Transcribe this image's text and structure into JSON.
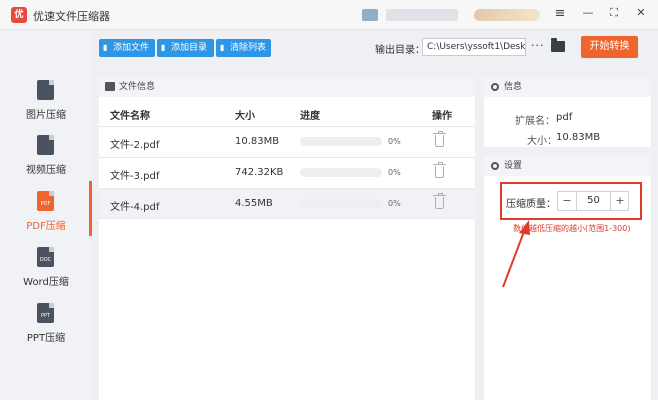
{
  "app": {
    "title": "优速文件压缩器",
    "logo_text": "优"
  },
  "window_controls": [
    "≡",
    "—",
    "⛶",
    "✕"
  ],
  "sidebar": {
    "items": [
      {
        "label": "图片压缩",
        "icon": "image-file-icon",
        "badge": ""
      },
      {
        "label": "视频压缩",
        "icon": "video-file-icon",
        "badge": ""
      },
      {
        "label": "PDF压缩",
        "icon": "pdf-file-icon",
        "badge": "PDF"
      },
      {
        "label": "Word压缩",
        "icon": "doc-file-icon",
        "badge": "DOC"
      },
      {
        "label": "PPT压缩",
        "icon": "ppt-file-icon",
        "badge": "PPT"
      }
    ]
  },
  "toolbar": {
    "add_file": "添加文件",
    "add_dir": "添加目录",
    "clear_list": "清除列表",
    "output_label": "输出目录：",
    "output_path": "C:\\Users\\yssoft1\\Deskt",
    "more": "···",
    "start": "开始转换"
  },
  "file_panel": {
    "title": "文件信息",
    "columns": {
      "name": "文件名称",
      "size": "大小",
      "progress": "进度",
      "action": "操作"
    },
    "rows": [
      {
        "name": "文件-2.pdf",
        "size": "10.83MB",
        "progress": "0%"
      },
      {
        "name": "文件-3.pdf",
        "size": "742.32KB",
        "progress": "0%"
      },
      {
        "name": "文件-4.pdf",
        "size": "4.55MB",
        "progress": "0%"
      }
    ]
  },
  "info_panel": {
    "title": "信息",
    "ext_label": "扩展名：",
    "ext_value": "pdf",
    "size_label": "大小：",
    "size_value": "10.83MB"
  },
  "settings": {
    "title": "设置",
    "quality_label": "压缩质量：",
    "minus": "−",
    "value": "50",
    "plus": "+",
    "hint": "数值越低压缩的越小(范围1-300)"
  },
  "colors": {
    "accent": "#f0642d",
    "primary": "#2d96e6",
    "annotation": "#e03a2d"
  }
}
